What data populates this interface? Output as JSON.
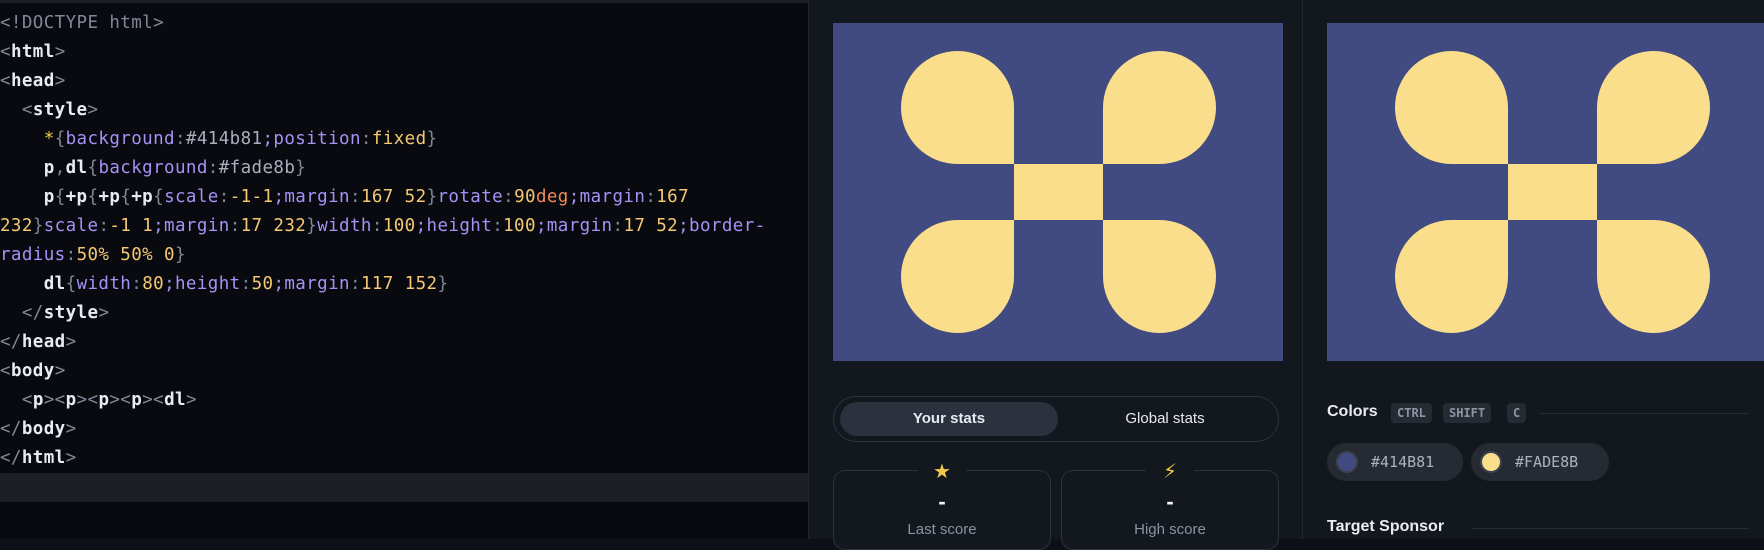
{
  "editor": {
    "lines": [
      [
        [
          "t-punc",
          "<!DOCTYPE html>"
        ]
      ],
      [
        [
          "t-punc",
          "<"
        ],
        [
          "t-tag",
          "html"
        ],
        [
          "t-punc",
          ">"
        ]
      ],
      [
        [
          "t-punc",
          "<"
        ],
        [
          "t-tag",
          "head"
        ],
        [
          "t-punc",
          ">"
        ]
      ],
      [
        [
          "t-punc",
          "  <"
        ],
        [
          "t-tag",
          "style"
        ],
        [
          "t-punc",
          ">"
        ]
      ],
      [
        [
          "t-punc",
          "    "
        ],
        [
          "t-sel",
          "*"
        ],
        [
          "t-punc",
          "{"
        ],
        [
          "t-prop",
          "background"
        ],
        [
          "t-punc",
          ":"
        ],
        [
          "t-hex",
          "#414b81"
        ],
        [
          "t-prop",
          ";position"
        ],
        [
          "t-punc",
          ":"
        ],
        [
          "t-val",
          "fixed"
        ],
        [
          "t-punc",
          "}"
        ]
      ],
      [
        [
          "t-punc",
          "    "
        ],
        [
          "t-tag",
          "p"
        ],
        [
          "t-punc",
          ","
        ],
        [
          "t-tag",
          "dl"
        ],
        [
          "t-punc",
          "{"
        ],
        [
          "t-prop",
          "background"
        ],
        [
          "t-punc",
          ":"
        ],
        [
          "t-hex",
          "#fade8b"
        ],
        [
          "t-punc",
          "}"
        ]
      ],
      [
        [
          "t-punc",
          "    "
        ],
        [
          "t-tag",
          "p"
        ],
        [
          "t-punc",
          "{"
        ],
        [
          "t-tag",
          "+p"
        ],
        [
          "t-punc",
          "{"
        ],
        [
          "t-tag",
          "+p"
        ],
        [
          "t-punc",
          "{"
        ],
        [
          "t-tag",
          "+p"
        ],
        [
          "t-punc",
          "{"
        ],
        [
          "t-prop",
          "scale"
        ],
        [
          "t-punc",
          ":"
        ],
        [
          "t-val",
          "-1-1"
        ],
        [
          "t-prop",
          ";margin"
        ],
        [
          "t-punc",
          ":"
        ],
        [
          "t-val",
          "167 52"
        ],
        [
          "t-punc",
          "}"
        ],
        [
          "t-prop",
          "rotate"
        ],
        [
          "t-punc",
          ":"
        ],
        [
          "t-val",
          "90"
        ],
        [
          "t-unit",
          "deg"
        ],
        [
          "t-prop",
          ";margin"
        ],
        [
          "t-punc",
          ":"
        ],
        [
          "t-val",
          "167"
        ]
      ],
      [
        [
          "t-val",
          "232"
        ],
        [
          "t-punc",
          "}"
        ],
        [
          "t-prop",
          "scale"
        ],
        [
          "t-punc",
          ":"
        ],
        [
          "t-val",
          "-1 1"
        ],
        [
          "t-prop",
          ";margin"
        ],
        [
          "t-punc",
          ":"
        ],
        [
          "t-val",
          "17 232"
        ],
        [
          "t-punc",
          "}"
        ],
        [
          "t-prop",
          "width"
        ],
        [
          "t-punc",
          ":"
        ],
        [
          "t-val",
          "100"
        ],
        [
          "t-prop",
          ";height"
        ],
        [
          "t-punc",
          ":"
        ],
        [
          "t-val",
          "100"
        ],
        [
          "t-prop",
          ";margin"
        ],
        [
          "t-punc",
          ":"
        ],
        [
          "t-val",
          "17 52"
        ],
        [
          "t-prop",
          ";border-"
        ]
      ],
      [
        [
          "t-prop",
          "radius"
        ],
        [
          "t-punc",
          ":"
        ],
        [
          "t-val",
          "50% 50% 0"
        ],
        [
          "t-punc",
          "}"
        ]
      ],
      [
        [
          "t-punc",
          "    "
        ],
        [
          "t-tag",
          "dl"
        ],
        [
          "t-punc",
          "{"
        ],
        [
          "t-prop",
          "width"
        ],
        [
          "t-punc",
          ":"
        ],
        [
          "t-val",
          "80"
        ],
        [
          "t-prop",
          ";height"
        ],
        [
          "t-punc",
          ":"
        ],
        [
          "t-val",
          "50"
        ],
        [
          "t-prop",
          ";margin"
        ],
        [
          "t-punc",
          ":"
        ],
        [
          "t-val",
          "117 152"
        ],
        [
          "t-punc",
          "}"
        ]
      ],
      [
        [
          "t-punc",
          "  </"
        ],
        [
          "t-tag",
          "style"
        ],
        [
          "t-punc",
          ">"
        ]
      ],
      [
        [
          "t-punc",
          "</"
        ],
        [
          "t-tag",
          "head"
        ],
        [
          "t-punc",
          ">"
        ]
      ],
      [
        [
          "t-punc",
          "<"
        ],
        [
          "t-tag",
          "body"
        ],
        [
          "t-punc",
          ">"
        ]
      ],
      [
        [
          "t-punc",
          "  <"
        ],
        [
          "t-tag",
          "p"
        ],
        [
          "t-punc",
          "><"
        ],
        [
          "t-tag",
          "p"
        ],
        [
          "t-punc",
          "><"
        ],
        [
          "t-tag",
          "p"
        ],
        [
          "t-punc",
          "><"
        ],
        [
          "t-tag",
          "p"
        ],
        [
          "t-punc",
          "><"
        ],
        [
          "t-tag",
          "dl"
        ],
        [
          "t-punc",
          ">"
        ]
      ],
      [
        [
          "t-punc",
          "</"
        ],
        [
          "t-tag",
          "body"
        ],
        [
          "t-punc",
          ">"
        ]
      ],
      [
        [
          "t-punc",
          "</"
        ],
        [
          "t-tag",
          "html"
        ],
        [
          "t-punc",
          ">"
        ]
      ],
      []
    ]
  },
  "colors": {
    "background": "#414b81",
    "foreground": "#fade8b"
  },
  "stats": {
    "tabs": [
      "Your stats",
      "Global stats"
    ],
    "last_score": {
      "icon": "star-icon",
      "value": "-",
      "label": "Last score"
    },
    "high_score": {
      "icon": "bolt-icon",
      "value": "-",
      "label": "High score"
    }
  },
  "colors_section": {
    "title": "Colors",
    "keys": [
      "CTRL",
      "SHIFT",
      "C"
    ],
    "swatches": [
      {
        "label": "#414B81",
        "color": "#414b81"
      },
      {
        "label": "#FADE8B",
        "color": "#fade8b"
      }
    ]
  },
  "sponsor": {
    "title": "Target Sponsor"
  }
}
